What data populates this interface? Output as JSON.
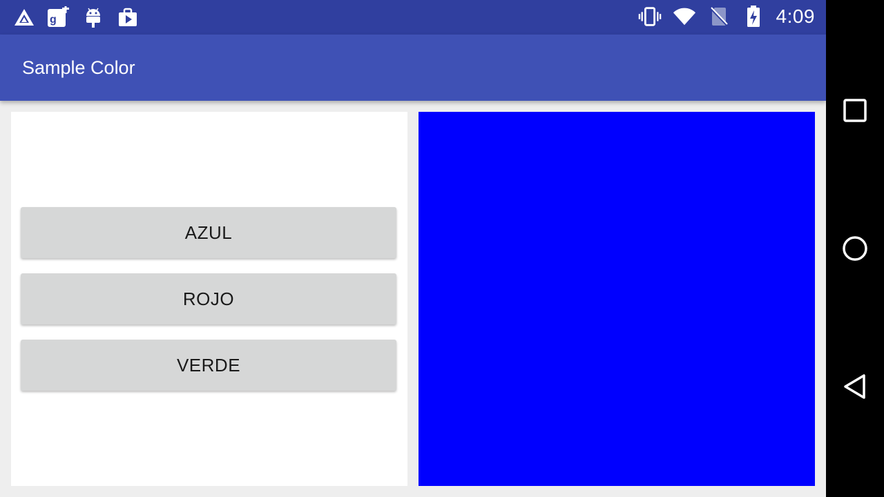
{
  "status_bar": {
    "time": "4:09",
    "left_icons": [
      "arrow-triangle-icon",
      "google-plus-icon",
      "android-icon",
      "play-store-icon"
    ],
    "right_icons": [
      "vibrate-icon",
      "wifi-icon",
      "no-sim-icon",
      "battery-charging-icon"
    ]
  },
  "app_bar": {
    "title": "Sample Color"
  },
  "buttons": [
    {
      "label": "AZUL"
    },
    {
      "label": "ROJO"
    },
    {
      "label": "VERDE"
    }
  ],
  "color_view": {
    "color": "#0000ff"
  },
  "nav_bar": {
    "items": [
      "recents-square-icon",
      "home-circle-icon",
      "back-triangle-icon"
    ]
  },
  "theme": {
    "primary": "#3f51b5",
    "primary_dark": "#303f9f",
    "button_bg": "#d6d7d7",
    "background": "#eeeeee"
  }
}
